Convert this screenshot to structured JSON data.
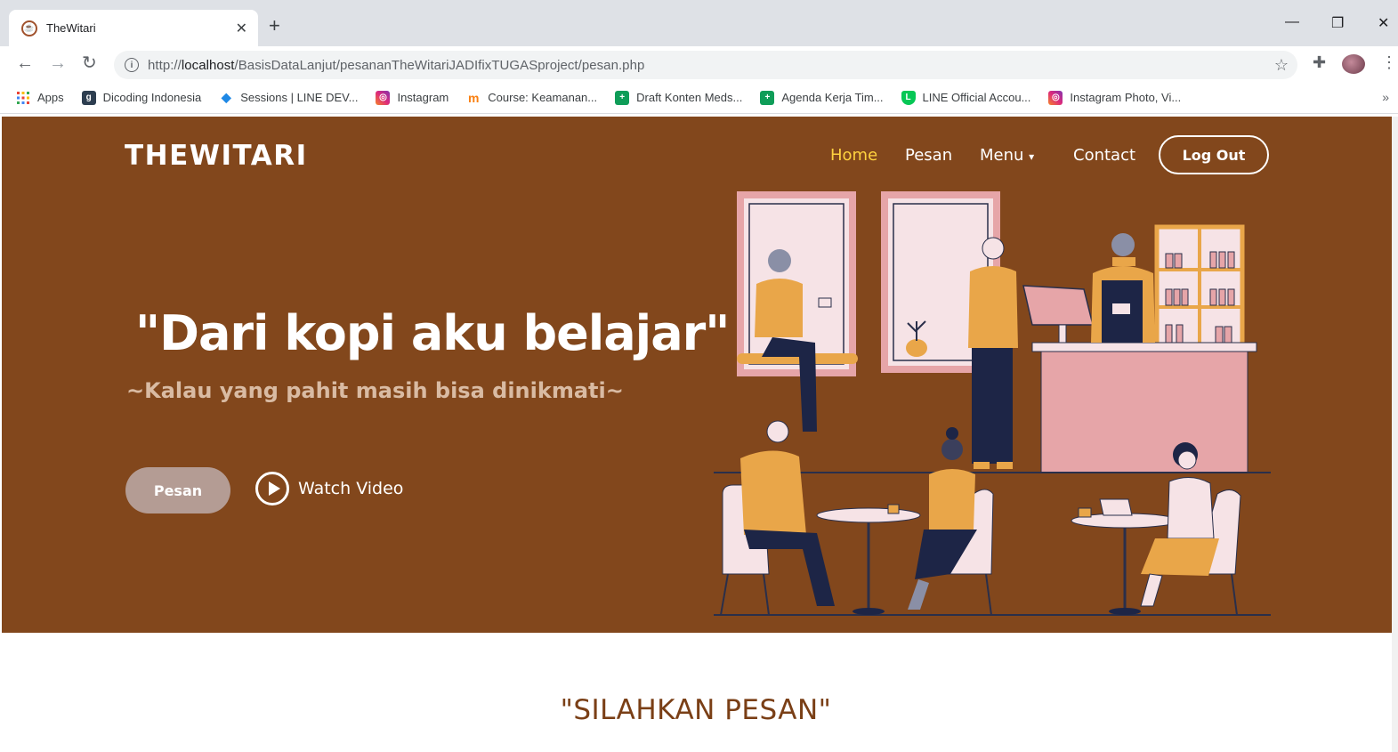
{
  "browser": {
    "tab_title": "TheWitari",
    "url_prefix": "http://",
    "url_host": "localhost",
    "url_path": "/BasisDataLanjut/pesananTheWitariJADIfixTUGASproject/pesan.php",
    "bookmarks": [
      {
        "label": "Apps",
        "icon": "apps-grid-icon",
        "color": "#ea4335"
      },
      {
        "label": "Dicoding Indonesia",
        "icon": "dicoding-icon",
        "color": "#2d3e50"
      },
      {
        "label": "Sessions | LINE DEV...",
        "icon": "line-dev-icon",
        "color": "#06c755"
      },
      {
        "label": "Instagram",
        "icon": "instagram-icon",
        "color": "#e1306c"
      },
      {
        "label": "Course: Keamanan...",
        "icon": "moodle-icon",
        "color": "#f98012"
      },
      {
        "label": "Draft Konten Meds...",
        "icon": "sheets-icon",
        "color": "#0f9d58"
      },
      {
        "label": "Agenda Kerja Tim...",
        "icon": "sheets-icon",
        "color": "#0f9d58"
      },
      {
        "label": "LINE Official Accou...",
        "icon": "line-shield-icon",
        "color": "#06c755"
      },
      {
        "label": "Instagram Photo, Vi...",
        "icon": "instagram-icon",
        "color": "#e1306c"
      }
    ]
  },
  "site": {
    "brand": "THEWITARI",
    "nav": {
      "home": "Home",
      "pesan": "Pesan",
      "menu": "Menu",
      "contact": "Contact",
      "logout": "Log Out"
    },
    "hero": {
      "headline": "\"Dari kopi aku belajar\"",
      "subline": "~Kalau yang pahit masih bisa dinikmati~",
      "cta": "Pesan",
      "watch": "Watch Video"
    },
    "section_title": "\"SILAHKAN PESAN\"",
    "colors": {
      "hero_bg": "#82471c",
      "nav_active": "#ffd23f",
      "cta_bg": "#b49c94",
      "section_title": "#7a3f16"
    }
  }
}
